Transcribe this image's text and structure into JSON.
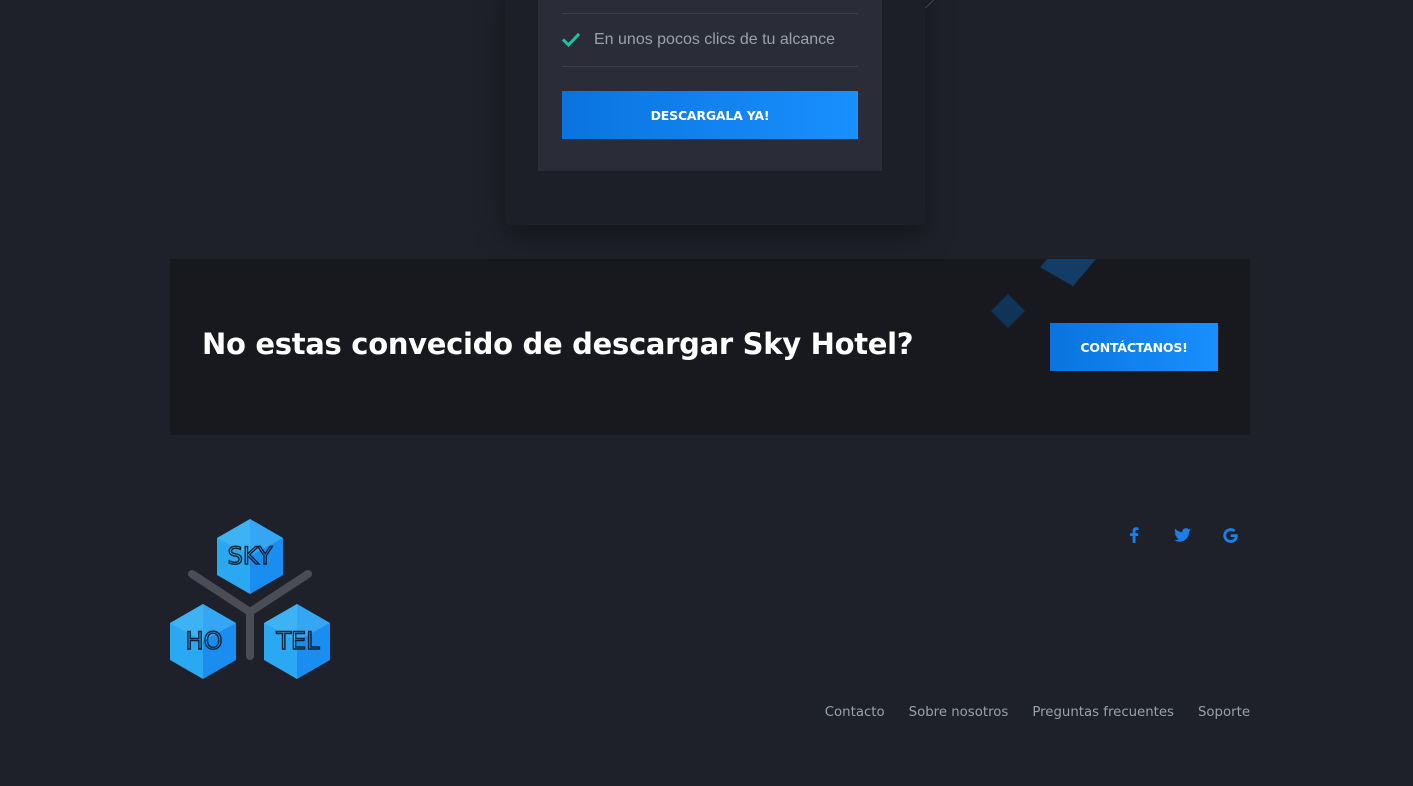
{
  "pricing_card": {
    "feature": "En unos pocos clics de tu alcance",
    "download_label": "DESCARGALA YA!"
  },
  "cta": {
    "heading": "No estas convecido de descargar Sky Hotel?",
    "button_label": "CONTÁCTANOS!"
  },
  "logo": {
    "part_top": "SKY",
    "part_left": "HO",
    "part_right": "TEL"
  },
  "social": [
    {
      "icon": "facebook-icon"
    },
    {
      "icon": "twitter-icon"
    },
    {
      "icon": "google-icon"
    }
  ],
  "footer_nav": [
    "Contacto",
    "Sobre nosotros",
    "Preguntas frecuentes",
    "Soporte"
  ],
  "colors": {
    "background": "#1e212a",
    "card": "#2a2d37",
    "banner": "#17191e",
    "accent": "#0a74de",
    "check": "#1fc1a4",
    "link": "#9aa1ad"
  }
}
